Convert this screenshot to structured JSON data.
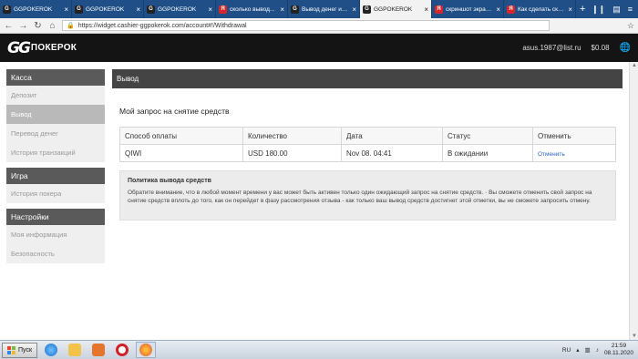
{
  "browser": {
    "tabs": [
      {
        "title": "GGPOKEROK",
        "fav": "gg",
        "color": "#222222",
        "active": false
      },
      {
        "title": "GGPOKEROK",
        "fav": "gg",
        "color": "#222222",
        "active": false
      },
      {
        "title": "GGPOKEROK",
        "fav": "gg",
        "color": "#222222",
        "active": false
      },
      {
        "title": "сколько вывод...",
        "fav": "yandex",
        "color": "#d9262a",
        "active": false
      },
      {
        "title": "Вывод денег из Р...",
        "fav": "gg",
        "color": "#222222",
        "active": false
      },
      {
        "title": "GGPOKEROK",
        "fav": "gg",
        "color": "#222222",
        "active": true
      },
      {
        "title": "скриншот экрана...",
        "fav": "yandex",
        "color": "#d9262a",
        "active": false
      },
      {
        "title": "Как сделать скри...",
        "fav": "yandex",
        "color": "#d9262a",
        "active": false
      }
    ],
    "new_tab": "+",
    "url": "https://widget.cashier-ggpokerok.com/account#!/Withdrawal",
    "url_icon": "lock-icon"
  },
  "site": {
    "logo_mark": "GG",
    "logo_text": "ПОКЕРОК",
    "user_email": "asus.1987@list.ru",
    "balance": "$0.08",
    "globe_icon": "globe-icon"
  },
  "sidebar": {
    "sections": [
      {
        "title": "Касса",
        "items": [
          {
            "label": "Депозит",
            "active": false
          },
          {
            "label": "Вывод",
            "active": true
          },
          {
            "label": "Перевод денег",
            "active": false
          },
          {
            "label": "История транзакций",
            "active": false
          }
        ]
      },
      {
        "title": "Игра",
        "items": [
          {
            "label": "История покера",
            "active": false
          }
        ]
      },
      {
        "title": "Настройки",
        "items": [
          {
            "label": "Моя информация",
            "active": false
          },
          {
            "label": "Безопасность",
            "active": false
          }
        ]
      }
    ]
  },
  "main": {
    "header": "Вывод",
    "subtitle": "Мой запрос на снятие средств",
    "table": {
      "columns": [
        "Способ оплаты",
        "Количество",
        "Дата",
        "Статус",
        "Отменить"
      ],
      "rows": [
        {
          "method": "QIWI",
          "amount": "USD 180.00",
          "date": "Nov 08. 04:41",
          "status": "В ожидании",
          "cancel": "Отменить"
        }
      ]
    },
    "policy": {
      "title": "Политика вывода средств",
      "text": "Обратите внимание, что в любой момент времени у вас может быть активен только один ожидающий запрос на снятие средств. · Вы сможете отменить свой запрос на снятие средств вплоть до того, как он перейдет в фазу рассмотрения отзыва - как только ваш вывод средств достигнет этой отметки, вы не сможете запросить отмену."
    }
  },
  "taskbar": {
    "start_label": "Пуск",
    "language": "RU",
    "time": "21:59",
    "date": "08.11.2020"
  }
}
